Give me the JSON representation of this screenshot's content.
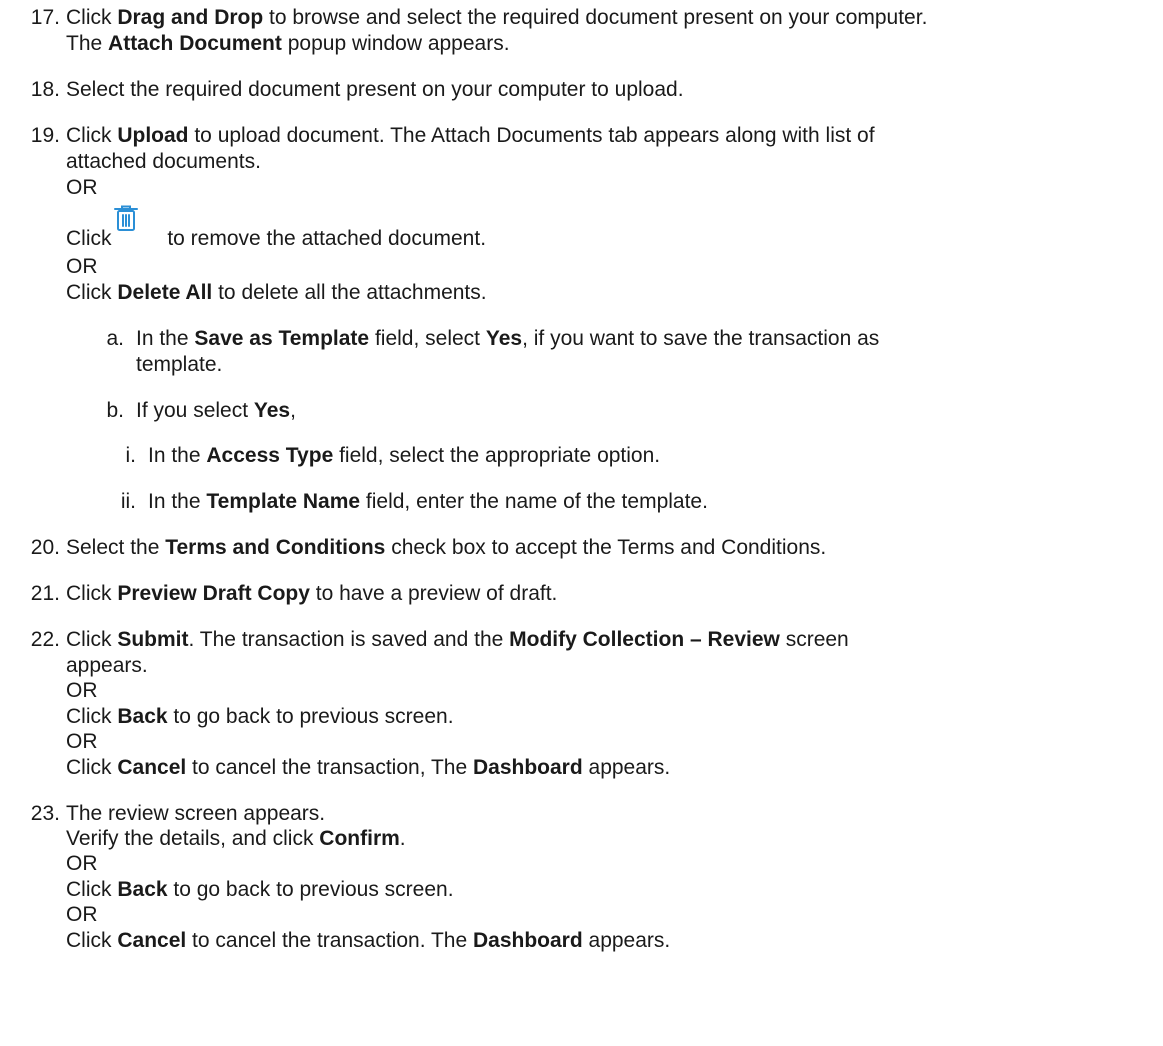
{
  "steps": {
    "s17": {
      "num": "17.",
      "l1": [
        {
          "t": "Click "
        },
        {
          "t": "Drag and Drop",
          "b": true
        },
        {
          "t": " to browse and select the required document present on your computer."
        }
      ],
      "l2": [
        {
          "t": "The "
        },
        {
          "t": "Attach Document",
          "b": true
        },
        {
          "t": " popup window appears."
        }
      ]
    },
    "s18": {
      "num": "18.",
      "l1": [
        {
          "t": "Select the required document present on your computer to upload."
        }
      ]
    },
    "s19": {
      "num": "19.",
      "l1": [
        {
          "t": "Click "
        },
        {
          "t": "Upload",
          "b": true
        },
        {
          "t": " to upload document. The Attach Documents tab appears along with list of"
        }
      ],
      "l2": [
        {
          "t": "attached documents."
        }
      ],
      "or1": " OR",
      "l3_pre": "Click",
      "l3_post": " to remove the attached document.",
      "trash_icon": "trash-icon",
      "trash_color": "#2b8fd6",
      "or2": "OR",
      "l4": [
        {
          "t": "Click "
        },
        {
          "t": "Delete All",
          "b": true
        },
        {
          "t": " to delete all the attachments."
        }
      ],
      "a_marker": "a.",
      "a_l1": [
        {
          "t": "In the "
        },
        {
          "t": "Save as Template",
          "b": true
        },
        {
          "t": " field, select "
        },
        {
          "t": "Yes",
          "b": true
        },
        {
          "t": ", if you want to save the transaction as"
        }
      ],
      "a_l2": [
        {
          "t": "template."
        }
      ],
      "b_marker": "b.",
      "b_l1": [
        {
          "t": "If you select "
        },
        {
          "t": "Yes",
          "b": true
        },
        {
          "t": ","
        }
      ],
      "i_marker": "i.",
      "i_l1": [
        {
          "t": "In the "
        },
        {
          "t": "Access Type",
          "b": true
        },
        {
          "t": " field, select the appropriate option."
        }
      ],
      "ii_marker": "ii.",
      "ii_l1": [
        {
          "t": "In the "
        },
        {
          "t": "Template Name",
          "b": true
        },
        {
          "t": " field, enter the name of the template."
        }
      ]
    },
    "s20": {
      "num": "20.",
      "l1": [
        {
          "t": "Select the "
        },
        {
          "t": "Terms and Conditions",
          "b": true
        },
        {
          "t": " check box to accept the Terms and Conditions."
        }
      ]
    },
    "s21": {
      "num": "21.",
      "l1": [
        {
          "t": "Click "
        },
        {
          "t": "Preview Draft Copy",
          "b": true
        },
        {
          "t": " to have a preview of draft."
        }
      ]
    },
    "s22": {
      "num": "22.",
      "l1": [
        {
          "t": "Click "
        },
        {
          "t": "Submit",
          "b": true
        },
        {
          "t": ". The transaction is saved and the "
        },
        {
          "t": "Modify Collection – Review",
          "b": true
        },
        {
          "t": " screen"
        }
      ],
      "l2": [
        {
          "t": "appears."
        }
      ],
      "or1": "OR",
      "l3": [
        {
          "t": "Click "
        },
        {
          "t": "Back",
          "b": true
        },
        {
          "t": " to go back to previous screen."
        }
      ],
      "or2": "OR",
      "l4": [
        {
          "t": "Click "
        },
        {
          "t": "Cancel",
          "b": true
        },
        {
          "t": " to cancel the transaction, The "
        },
        {
          "t": "Dashboard",
          "b": true
        },
        {
          "t": " appears."
        }
      ]
    },
    "s23": {
      "num": "23.",
      "l1": [
        {
          "t": "The review screen appears."
        }
      ],
      "l2": [
        {
          "t": "Verify the details, and click "
        },
        {
          "t": "Confirm",
          "b": true
        },
        {
          "t": "."
        }
      ],
      "or1": "OR",
      "l3": [
        {
          "t": "Click "
        },
        {
          "t": "Back",
          "b": true
        },
        {
          "t": " to go back to previous screen."
        }
      ],
      "or2": "OR",
      "l4": [
        {
          "t": "Click "
        },
        {
          "t": "Cancel",
          "b": true
        },
        {
          "t": " to cancel the transaction. The "
        },
        {
          "t": "Dashboard",
          "b": true
        },
        {
          "t": " appears."
        }
      ]
    }
  }
}
